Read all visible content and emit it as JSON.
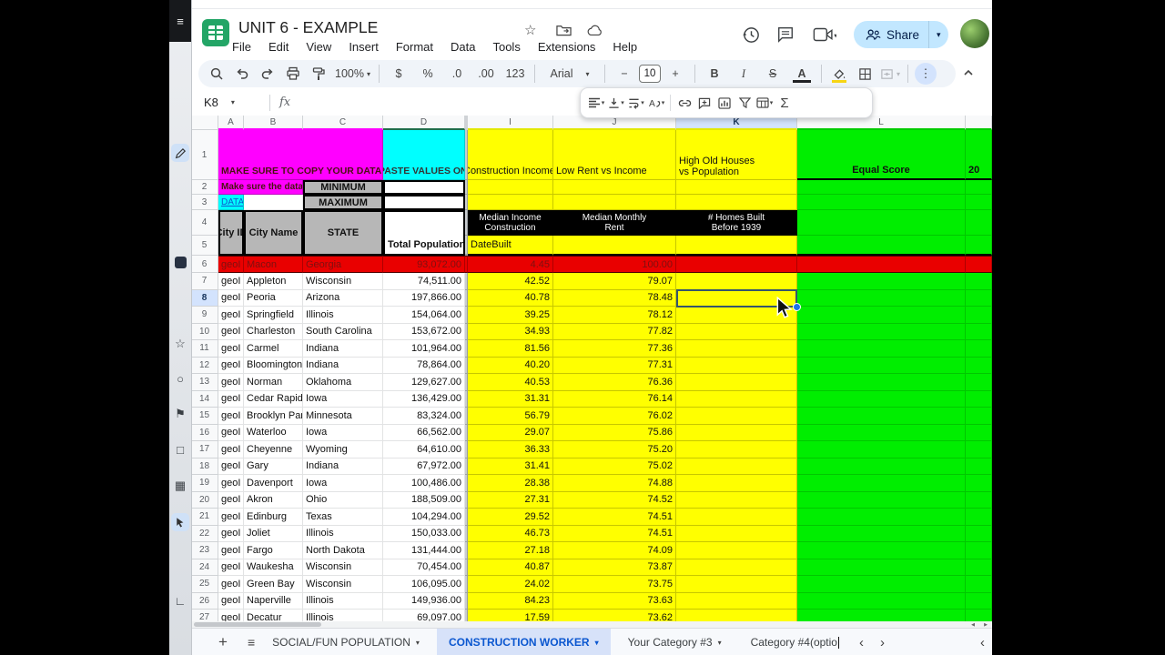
{
  "app": {
    "title": "UNIT 6 - EXAMPLE",
    "menu_items": [
      "File",
      "Edit",
      "View",
      "Insert",
      "Format",
      "Data",
      "Tools",
      "Extensions",
      "Help"
    ],
    "share_label": "Share"
  },
  "toolbar": {
    "zoom": "100%",
    "currency": "$",
    "percent": "%",
    "decrease_decimal": ".0",
    "increase_decimal": ".00",
    "more_formats": "123",
    "font_family": "Arial",
    "minus": "−",
    "font_size": "10",
    "plus": "+",
    "bold": "B",
    "italic": "I",
    "strikethrough": "S",
    "text_color": "A",
    "more": "⋮",
    "sum": "Σ"
  },
  "formula_bar": {
    "name_box": "K8",
    "fx_label": "fx",
    "value": ""
  },
  "side_tools": [
    {
      "name": "menu-icon",
      "glyph": "≡"
    },
    {
      "name": "pen-icon",
      "glyph": ""
    },
    {
      "name": "board-icon",
      "glyph": ""
    },
    {
      "name": "star-icon",
      "glyph": "☆"
    },
    {
      "name": "circle-icon",
      "glyph": "○"
    },
    {
      "name": "flag-icon",
      "glyph": "⚑"
    },
    {
      "name": "square-icon",
      "glyph": "□"
    },
    {
      "name": "grid-icon",
      "glyph": "▦"
    },
    {
      "name": "pointer-icon",
      "glyph": ""
    },
    {
      "name": "corner-icon",
      "glyph": "∟"
    }
  ],
  "grid": {
    "column_letters": [
      "A",
      "B",
      "C",
      "D",
      "I",
      "J",
      "K",
      "L",
      ""
    ],
    "r1": {
      "num": "1",
      "banner_left": "MAKE SURE TO COPY YOUR DATA",
      "banner_right": "PASTE VALUES ONLY",
      "col_i": "Construction Income",
      "col_j": "Low Rent vs Income",
      "col_k1": "High Old Houses",
      "col_k2": "vs Population",
      "col_l": "Equal Score",
      "col_m": "20"
    },
    "r2": {
      "num": "2",
      "note": "Make sure the data",
      "minimum": "MINIMUM"
    },
    "r3": {
      "num": "3",
      "data_link": "DATA",
      "maximum": "MAXIMUM"
    },
    "r4": {
      "num": "4",
      "city_id": "City ID",
      "city_name": "City Name",
      "state": "STATE",
      "i1": "Median Income",
      "i2": "Construction",
      "j1": "Median Monthly",
      "j2": "Rent",
      "k1": "# Homes Built",
      "k2": "Before 1939"
    },
    "r5": {
      "num": "5",
      "total_population": "Total Population",
      "date_built": "DateBuilt"
    },
    "rows": [
      {
        "num": "6",
        "city_id": "geoI",
        "city": "Macon",
        "state": "Georgia",
        "population": "93,072.00",
        "construction_income": "4.45",
        "rent_vs_income": "100.00",
        "red": true
      },
      {
        "num": "7",
        "city_id": "geoI",
        "city": "Appleton",
        "state": "Wisconsin",
        "population": "74,511.00",
        "construction_income": "42.52",
        "rent_vs_income": "79.07"
      },
      {
        "num": "8",
        "city_id": "geoI",
        "city": "Peoria",
        "state": "Arizona",
        "population": "197,866.00",
        "construction_income": "40.78",
        "rent_vs_income": "78.48",
        "selected": true
      },
      {
        "num": "9",
        "city_id": "geoI",
        "city": "Springfield",
        "state": "Illinois",
        "population": "154,064.00",
        "construction_income": "39.25",
        "rent_vs_income": "78.12"
      },
      {
        "num": "10",
        "city_id": "geoI",
        "city": "Charleston",
        "state": "South Carolina",
        "population": "153,672.00",
        "construction_income": "34.93",
        "rent_vs_income": "77.82"
      },
      {
        "num": "11",
        "city_id": "geoI",
        "city": "Carmel",
        "state": "Indiana",
        "population": "101,964.00",
        "construction_income": "81.56",
        "rent_vs_income": "77.36"
      },
      {
        "num": "12",
        "city_id": "geoI",
        "city": "Bloomington",
        "state": "Indiana",
        "population": "78,864.00",
        "construction_income": "40.20",
        "rent_vs_income": "77.31"
      },
      {
        "num": "13",
        "city_id": "geoI",
        "city": "Norman",
        "state": "Oklahoma",
        "population": "129,627.00",
        "construction_income": "40.53",
        "rent_vs_income": "76.36"
      },
      {
        "num": "14",
        "city_id": "geoI",
        "city": "Cedar Rapids",
        "state": "Iowa",
        "population": "136,429.00",
        "construction_income": "31.31",
        "rent_vs_income": "76.14"
      },
      {
        "num": "15",
        "city_id": "geoI",
        "city": "Brooklyn Park",
        "state": "Minnesota",
        "population": "83,324.00",
        "construction_income": "56.79",
        "rent_vs_income": "76.02"
      },
      {
        "num": "16",
        "city_id": "geoI",
        "city": "Waterloo",
        "state": "Iowa",
        "population": "66,562.00",
        "construction_income": "29.07",
        "rent_vs_income": "75.86"
      },
      {
        "num": "17",
        "city_id": "geoI",
        "city": "Cheyenne",
        "state": "Wyoming",
        "population": "64,610.00",
        "construction_income": "36.33",
        "rent_vs_income": "75.20"
      },
      {
        "num": "18",
        "city_id": "geoI",
        "city": "Gary",
        "state": "Indiana",
        "population": "67,972.00",
        "construction_income": "31.41",
        "rent_vs_income": "75.02"
      },
      {
        "num": "19",
        "city_id": "geoI",
        "city": "Davenport",
        "state": "Iowa",
        "population": "100,486.00",
        "construction_income": "28.38",
        "rent_vs_income": "74.88"
      },
      {
        "num": "20",
        "city_id": "geoI",
        "city": "Akron",
        "state": "Ohio",
        "population": "188,509.00",
        "construction_income": "27.31",
        "rent_vs_income": "74.52"
      },
      {
        "num": "21",
        "city_id": "geoI",
        "city": "Edinburg",
        "state": "Texas",
        "population": "104,294.00",
        "construction_income": "29.52",
        "rent_vs_income": "74.51"
      },
      {
        "num": "22",
        "city_id": "geoI",
        "city": "Joliet",
        "state": "Illinois",
        "population": "150,033.00",
        "construction_income": "46.73",
        "rent_vs_income": "74.51"
      },
      {
        "num": "23",
        "city_id": "geoI",
        "city": "Fargo",
        "state": "North Dakota",
        "population": "131,444.00",
        "construction_income": "27.18",
        "rent_vs_income": "74.09"
      },
      {
        "num": "24",
        "city_id": "geoI",
        "city": "Waukesha",
        "state": "Wisconsin",
        "population": "70,454.00",
        "construction_income": "40.87",
        "rent_vs_income": "73.87"
      },
      {
        "num": "25",
        "city_id": "geoI",
        "city": "Green Bay",
        "state": "Wisconsin",
        "population": "106,095.00",
        "construction_income": "24.02",
        "rent_vs_income": "73.75"
      },
      {
        "num": "26",
        "city_id": "geoI",
        "city": "Naperville",
        "state": "Illinois",
        "population": "149,936.00",
        "construction_income": "84.23",
        "rent_vs_income": "73.63"
      },
      {
        "num": "27",
        "city_id": "geoI",
        "city": "Decatur",
        "state": "Illinois",
        "population": "69,097.00",
        "construction_income": "17.59",
        "rent_vs_income": "73.62"
      }
    ]
  },
  "sheet_tabs": {
    "add": "+",
    "all_sheets": "≡",
    "tabs": [
      {
        "label": "SOCIAL/FUN POPULATION",
        "active": false
      },
      {
        "label": "CONSTRUCTION WORKER",
        "active": true
      },
      {
        "label": "Your Category #3",
        "active": false
      },
      {
        "label": "Category #4(optio",
        "active": false,
        "editing": true
      }
    ],
    "prev": "‹",
    "next": "›",
    "scroll_left": "‹"
  },
  "colors": {
    "magenta": "#ff00ff",
    "cyan": "#00ffff",
    "yellow": "#ffff00",
    "green": "#00ee00",
    "row_red": "#e90000",
    "gray": "#b7b7b7",
    "active_tab_blue": "#0b57d0",
    "selection_border": "#35566b",
    "fill_handle_blue": "#1a73e8"
  }
}
